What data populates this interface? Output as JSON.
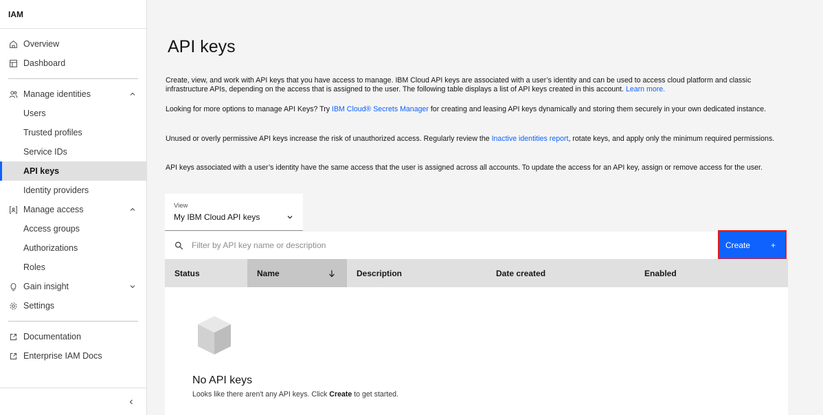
{
  "sidebar": {
    "title": "IAM",
    "items": [
      {
        "label": "Overview"
      },
      {
        "label": "Dashboard"
      },
      {
        "label": "Manage identities"
      },
      {
        "label": "Users"
      },
      {
        "label": "Trusted profiles"
      },
      {
        "label": "Service IDs"
      },
      {
        "label": "API keys"
      },
      {
        "label": "Identity providers"
      },
      {
        "label": "Manage access"
      },
      {
        "label": "Access groups"
      },
      {
        "label": "Authorizations"
      },
      {
        "label": "Roles"
      },
      {
        "label": "Gain insight"
      },
      {
        "label": "Settings"
      },
      {
        "label": "Documentation"
      },
      {
        "label": "Enterprise IAM Docs"
      }
    ]
  },
  "main": {
    "title": "API keys",
    "p1_text": "Create, view, and work with API keys that you have access to manage. IBM Cloud API keys are associated with a user’s identity and can be used to access cloud platform and classic infrastructure APIs, depending on the access that is assigned to the user. The following table displays a list of API keys created in this account.",
    "p1_link": "Learn more.",
    "p2_before": "Looking for more options to manage API Keys? Try",
    "p2_link": "IBM Cloud® Secrets Manager",
    "p2_after": "for creating and leasing API keys dynamically and storing them securely in your own dedicated instance.",
    "p3_before": "Unused or overly permissive API keys increase the risk of unauthorized access. Regularly review the",
    "p3_link": "Inactive identities report",
    "p3_after": ", rotate keys, and apply only the minimum required permissions.",
    "p4_text": "API keys associated with a user’s identity have the same access that the user is assigned across all accounts. To update the access for an API key, assign or remove access for the user.",
    "view_label": "View",
    "view_value": "My IBM Cloud API keys",
    "search_placeholder": "Filter by API key name or description",
    "create_label": "Create",
    "create_icon": "+",
    "columns": [
      "Status",
      "Name",
      "Description",
      "Date created",
      "Enabled"
    ],
    "empty_title": "No API keys",
    "empty_desc_before": "Looks like there aren't any API keys. Click",
    "empty_desc_bold": "Create",
    "empty_desc_after": "to get started."
  },
  "colors": {
    "accent": "#0f62fe",
    "highlight_border": "#da1e28"
  }
}
